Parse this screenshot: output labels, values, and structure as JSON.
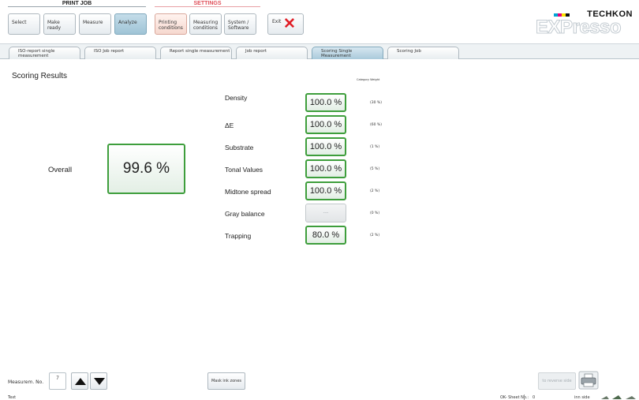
{
  "toolbar": {
    "print_job_label": "PRINT JOB",
    "settings_label": "SETTINGS",
    "buttons": [
      {
        "label": "Select"
      },
      {
        "label": "Make ready"
      },
      {
        "label": "Measure"
      },
      {
        "label": "Analyze",
        "active": true
      },
      {
        "label": "Printing conditions"
      },
      {
        "label": "Measuring conditions"
      },
      {
        "label": "System / Software"
      }
    ],
    "exit_label": "Exit",
    "exit_icon": "close-x-icon"
  },
  "logo": {
    "brand": "TECHKON",
    "product": "EXPresso",
    "flag_colors": [
      "#00a6d6",
      "#e4007c",
      "#ffe100",
      "#111111"
    ]
  },
  "tabs": [
    {
      "label": "ISO-report single measurement"
    },
    {
      "label": "ISO Job report"
    },
    {
      "label": "Report single measurement"
    },
    {
      "label": "Job report"
    },
    {
      "label": "Scoring Single Measurement",
      "active": true
    },
    {
      "label": "Scoring Job"
    }
  ],
  "scoring": {
    "title": "Scoring Results",
    "category_weight_header": "Category Weight",
    "overall_label": "Overall",
    "overall_value": "99.6 %",
    "rows": [
      {
        "label": "Density",
        "value": "100.0 %",
        "weight": "(30 %)"
      },
      {
        "label": "ΔE",
        "value": "100.0 %",
        "weight": "(60 %)"
      },
      {
        "label": "Substrate",
        "value": "100.0 %",
        "weight": "(1 %)"
      },
      {
        "label": "Tonal Values",
        "value": "100.0 %",
        "weight": "(5 %)"
      },
      {
        "label": "Midtone spread",
        "value": "100.0 %",
        "weight": "(2 %)"
      },
      {
        "label": "Gray balance",
        "value": "----",
        "weight": "(0 %)",
        "disabled": true
      },
      {
        "label": "Trapping",
        "value": "80.0 %",
        "weight": "(2 %)"
      }
    ],
    "accent_color": "#3e9e3c"
  },
  "footer": {
    "measurement_label": "Measurem. No.",
    "measurement_no": "7",
    "mask_ink_zones_label": "Mask ink zones",
    "reverse_side_label": "to reverse side",
    "printer_icon": "printer-icon"
  },
  "status": {
    "text_label": "Text",
    "ok_sheet_label": "OK- Sheet No.:",
    "sheet_value": "0",
    "side_label": "inn side",
    "page_value": "1"
  }
}
